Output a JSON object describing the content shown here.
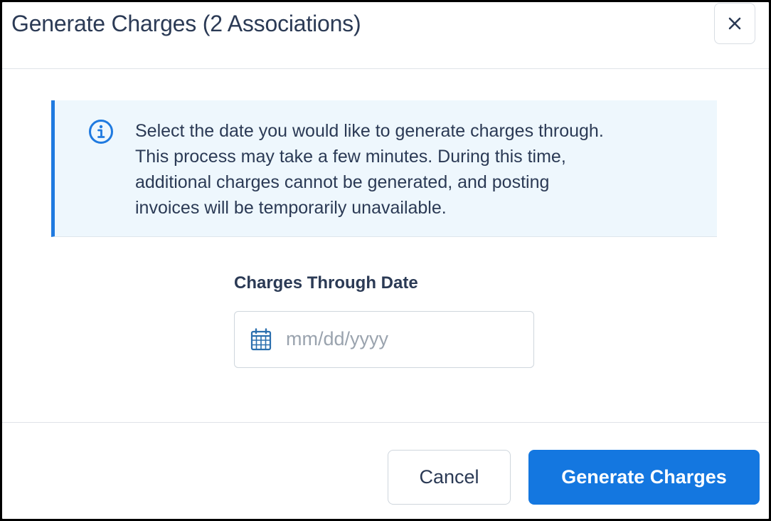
{
  "dialog": {
    "title": "Generate Charges (2 Associations)",
    "close_icon": "close-icon"
  },
  "info": {
    "icon": "info-circle-icon",
    "lines": [
      "Select the date you would like to generate charges through.",
      "This process may take a few minutes. During this time,",
      "additional charges cannot be generated, and posting",
      "invoices will be temporarily unavailable."
    ]
  },
  "form": {
    "label": "Charges Through Date",
    "date_placeholder": "mm/dd/yyyy",
    "date_value": "",
    "calendar_icon": "calendar-icon"
  },
  "footer": {
    "cancel_label": "Cancel",
    "generate_label": "Generate Charges"
  },
  "colors": {
    "primary": "#1477e0",
    "info_background": "#eef7fd",
    "info_accent": "#1f7ae0",
    "text": "#2b3a55",
    "placeholder": "#9aa3ae"
  }
}
